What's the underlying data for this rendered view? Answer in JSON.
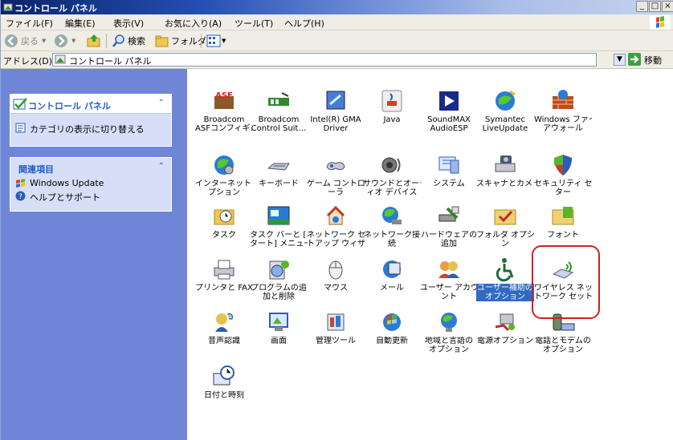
{
  "window": {
    "title": "コントロール パネル",
    "controls": [
      "_",
      "□",
      "×"
    ]
  },
  "menu": [
    "ファイル(F)",
    "編集(E)",
    "表示(V)",
    "お気に入り(A)",
    "ツール(T)",
    "ヘルプ(H)"
  ],
  "toolbar": {
    "back": "戻る",
    "search": "検索",
    "folders": "フォルダ"
  },
  "address": {
    "label": "アドレス(D)",
    "value": "コントロール パネル",
    "go": "移動"
  },
  "left_pane": {
    "cp_panel": {
      "title": "コントロール パネル",
      "link": "カテゴリの表示に切り替える"
    },
    "related": {
      "title": "関連項目",
      "links": [
        "Windows Update",
        "ヘルプとサポート"
      ]
    }
  },
  "items": [
    {
      "label": "Broadcom\nASFコンフィギ…",
      "icon": "asf-icon"
    },
    {
      "label": "Broadcom\nControl Suit…",
      "icon": "network-card-icon"
    },
    {
      "label": "Intel(R) GMA\nDriver",
      "icon": "intel-gma-icon"
    },
    {
      "label": "Java",
      "icon": "java-icon"
    },
    {
      "label": "SoundMAX\nAudioESP",
      "icon": "soundmax-icon"
    },
    {
      "label": "Symantec\nLiveUpdate",
      "icon": "liveupdate-icon"
    },
    {
      "label": "Windows ファイ\nアウォール",
      "icon": "firewall-icon"
    },
    {
      "label": "インターネット オ\nプション",
      "icon": "internet-options-icon"
    },
    {
      "label": "キーボード",
      "icon": "keyboard-icon"
    },
    {
      "label": "ゲーム コントロ\nーラ",
      "icon": "game-controller-icon"
    },
    {
      "label": "サウンドとオーデ\nィオ デバイス",
      "icon": "sound-icon"
    },
    {
      "label": "システム",
      "icon": "system-icon"
    },
    {
      "label": "スキャナとカメラ",
      "icon": "scanner-camera-icon"
    },
    {
      "label": "セキュリティ セン\nター",
      "icon": "security-center-icon"
    },
    {
      "label": "タスク",
      "icon": "scheduled-tasks-icon"
    },
    {
      "label": "タスク バーと [ス\nタート] メニュー",
      "icon": "taskbar-icon"
    },
    {
      "label": "ネットワーク セッ\nトアップ ウィザ…",
      "icon": "network-setup-icon"
    },
    {
      "label": "ネットワーク接\n続",
      "icon": "network-connections-icon"
    },
    {
      "label": "ハードウェアの\n追加",
      "icon": "add-hardware-icon"
    },
    {
      "label": "フォルダ オプショ\nン",
      "icon": "folder-options-icon"
    },
    {
      "label": "フォント",
      "icon": "fonts-icon"
    },
    {
      "label": "プリンタと FAX",
      "icon": "printers-icon"
    },
    {
      "label": "プログラムの追\n加と削除",
      "icon": "add-remove-programs-icon"
    },
    {
      "label": "マウス",
      "icon": "mouse-icon"
    },
    {
      "label": "メール",
      "icon": "mail-icon"
    },
    {
      "label": "ユーザー アカウ\nント",
      "icon": "user-accounts-icon"
    },
    {
      "label": "ユーザー補助の\nオプション",
      "icon": "accessibility-icon"
    },
    {
      "label": "ワイヤレス ネッ\nトワーク セット…",
      "icon": "wireless-network-icon"
    },
    {
      "label": "音声認識",
      "icon": "speech-icon"
    },
    {
      "label": "画面",
      "icon": "display-icon"
    },
    {
      "label": "管理ツール",
      "icon": "admin-tools-icon"
    },
    {
      "label": "自動更新",
      "icon": "automatic-updates-icon"
    },
    {
      "label": "地域と言語の\nオプション",
      "icon": "regional-language-icon"
    },
    {
      "label": "電源オプション",
      "icon": "power-options-icon"
    },
    {
      "label": "電話とモデムの\nオプション",
      "icon": "phone-modem-icon"
    },
    {
      "label": "日付と時刻",
      "icon": "date-time-icon"
    }
  ],
  "colors": {
    "selection": "#316ac5",
    "highlight_border": "#c82424",
    "left_pane_bg": "#6f86d8"
  }
}
